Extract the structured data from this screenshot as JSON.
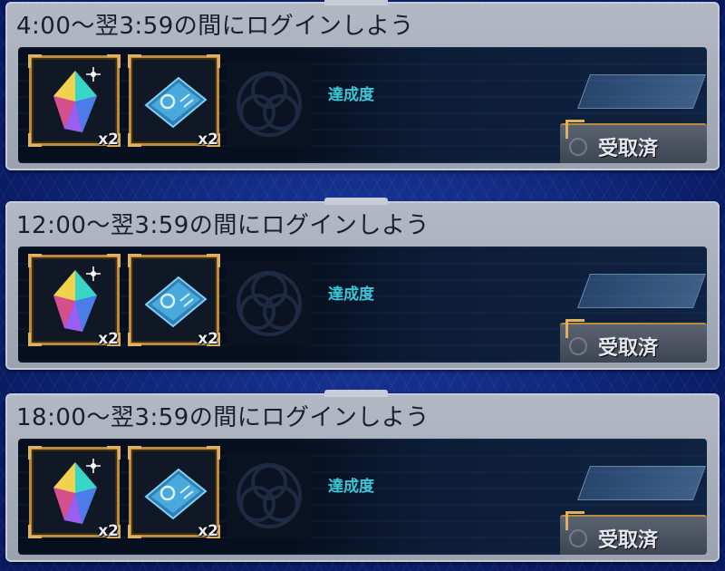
{
  "missions": [
    {
      "title": "4:00～翌3:59の間にログインしよう",
      "rewards": [
        {
          "icon": "crystal-icon",
          "qty": "x2"
        },
        {
          "icon": "ticket-icon",
          "qty": "x2"
        }
      ],
      "progress_label": "達成度",
      "button_label": "受取済"
    },
    {
      "title": "12:00～翌3:59の間にログインしよう",
      "rewards": [
        {
          "icon": "crystal-icon",
          "qty": "x2"
        },
        {
          "icon": "ticket-icon",
          "qty": "x2"
        }
      ],
      "progress_label": "達成度",
      "button_label": "受取済"
    },
    {
      "title": "18:00～翌3:59の間にログインしよう",
      "rewards": [
        {
          "icon": "crystal-icon",
          "qty": "x2"
        },
        {
          "icon": "ticket-icon",
          "qty": "x2"
        }
      ],
      "progress_label": "達成度",
      "button_label": "受取済"
    }
  ],
  "colors": {
    "background": "#0c1f6e",
    "card": "#b3b9c4",
    "frame_gold": "#b98b3e",
    "progress_text": "#3bc7d6"
  }
}
